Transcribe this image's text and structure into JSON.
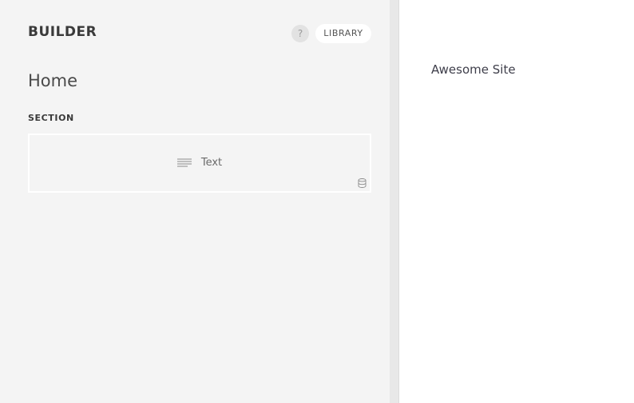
{
  "builder": {
    "brand": "BUILDER",
    "help_label": "?",
    "library_label": "LIBRARY",
    "page_title": "Home",
    "section_label": "SECTION",
    "block": {
      "label": "Text",
      "icon": "text-lines-icon",
      "data_icon": "database-icon"
    }
  },
  "preview": {
    "site_title": "Awesome Site"
  }
}
